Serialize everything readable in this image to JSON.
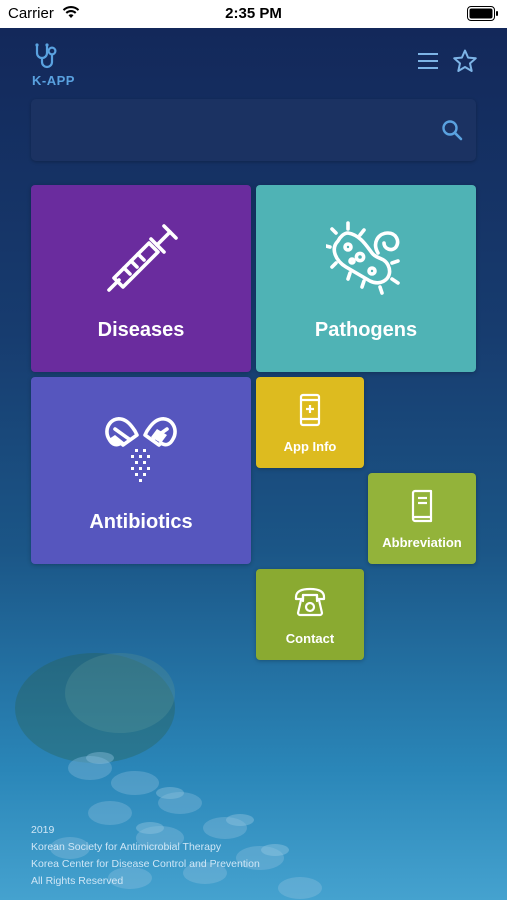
{
  "status_bar": {
    "carrier": "Carrier",
    "time": "2:35 PM"
  },
  "header": {
    "logo_text": "K-APP",
    "logo_icon": "stethoscope-icon",
    "menu_icon": "hamburger-menu-icon",
    "favorite_icon": "star-icon"
  },
  "search": {
    "value": "",
    "placeholder": "",
    "icon": "search-icon"
  },
  "tiles": {
    "diseases": {
      "label": "Diseases",
      "icon": "syringe-icon",
      "color": "#6a2c9e"
    },
    "pathogens": {
      "label": "Pathogens",
      "icon": "bacteria-icon",
      "color": "#4fb3b5"
    },
    "antibiotics": {
      "label": "Antibiotics",
      "icon": "capsules-icon",
      "color": "#5656be"
    },
    "app_info": {
      "label": "App Info",
      "icon": "phone-info-icon",
      "color": "#ddbb1f"
    },
    "abbreviation": {
      "label": "Abbreviation",
      "icon": "book-icon",
      "color": "#93b33a"
    },
    "contact": {
      "label": "Contact",
      "icon": "telephone-icon",
      "color": "#8aaa31"
    }
  },
  "footer": {
    "year": "2019",
    "org1": "Korean Society for Antimicrobial Therapy",
    "org2": "Korea Center for Disease Control and Prevention",
    "rights": "All Rights Reserved"
  }
}
